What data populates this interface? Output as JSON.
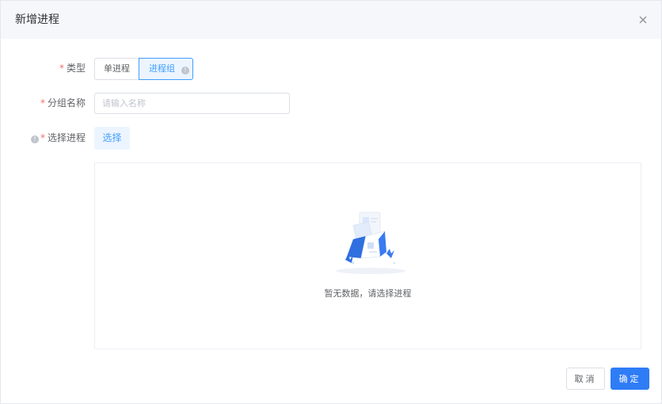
{
  "dialog": {
    "title": "新增进程",
    "close_icon": "close-icon"
  },
  "form": {
    "type": {
      "required_mark": "*",
      "label": "类型",
      "options": [
        "单进程",
        "进程组"
      ],
      "selected": "进程组",
      "info_icon": "info-icon"
    },
    "group_name": {
      "required_mark": "*",
      "label": "分组名称",
      "value": "",
      "placeholder": "请输入名称"
    },
    "process_select": {
      "info_icon": "info-icon",
      "required_mark": "*",
      "label": "选择进程",
      "button_label": "选择"
    }
  },
  "empty_state": {
    "illustration": "empty-documents-illustration",
    "text": "暂无数据，请选择进程"
  },
  "footer": {
    "cancel_label": "取消",
    "ok_label": "确定"
  },
  "colors": {
    "primary": "#2e7cf6",
    "accent_light": "#ecf5ff",
    "required": "#f56c6c",
    "header_bg": "#f5f7fa"
  }
}
